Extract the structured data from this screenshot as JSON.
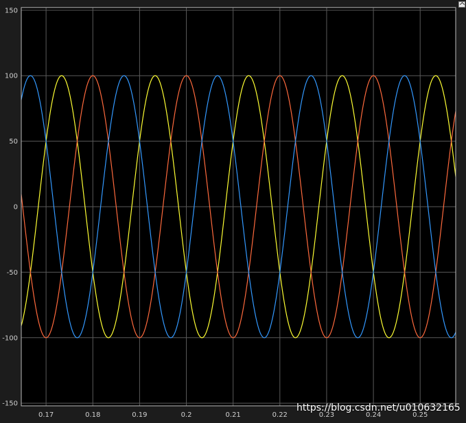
{
  "watermark": "https://blog.csdn.net/u010632165",
  "chart_data": {
    "type": "line",
    "title": "",
    "xlabel": "",
    "ylabel": "",
    "xlim": [
      0.1647,
      0.2576
    ],
    "ylim": [
      -152,
      152
    ],
    "grid": true,
    "background": "#000000",
    "gridColor": "#5a5a5a",
    "xticks": [
      0.17,
      0.18,
      0.19,
      0.2,
      0.21,
      0.22,
      0.23,
      0.24,
      0.25
    ],
    "xtickLabels": [
      "0.17",
      "0.18",
      "0.19",
      "0.2",
      "0.21",
      "0.22",
      "0.23",
      "0.24",
      "0.25"
    ],
    "yticks": [
      150,
      100,
      50,
      0,
      -50,
      -100,
      -150
    ],
    "ytickLabels": [
      "150",
      "100",
      "50",
      "0",
      "-50",
      "-100",
      "-150"
    ],
    "series": [
      {
        "amplitude": 100,
        "frequency_hz": 50,
        "phase_deg": 120,
        "color": "#ffff33"
      },
      {
        "amplitude": 100,
        "frequency_hz": 50,
        "phase_deg": 0,
        "color": "#ff6a3d"
      },
      {
        "amplitude": 100,
        "frequency_hz": 50,
        "phase_deg": -120,
        "color": "#3399ff"
      }
    ]
  }
}
